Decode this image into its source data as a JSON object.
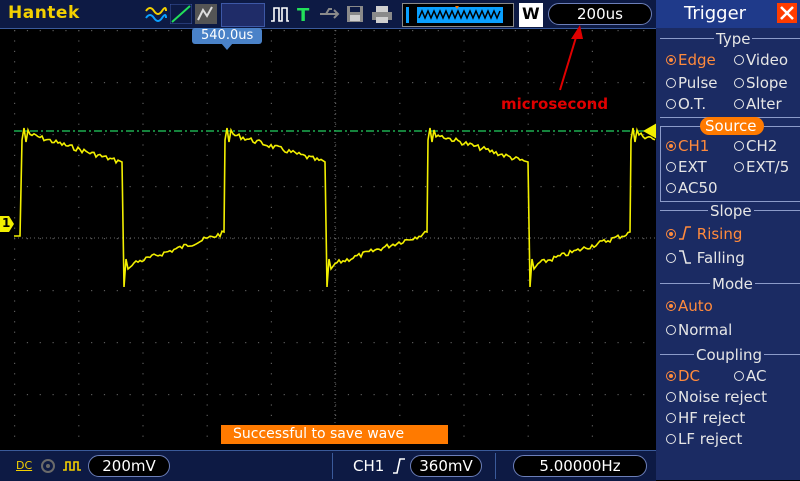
{
  "brand": "Hantek",
  "timebase": "200us",
  "trigger_position": "540.0us",
  "annotation": "microsecond",
  "status_message": "Successful to save wave",
  "acq_mode": "W",
  "channel1": {
    "marker": "1",
    "coupling": "DC",
    "volts_div": "200mV"
  },
  "trigger_readout": {
    "channel": "CH1",
    "level": "360mV",
    "frequency": "5.00000Hz"
  },
  "panel": {
    "title": "Trigger",
    "sections": {
      "type": {
        "title": "Type",
        "options": [
          "Edge",
          "Video",
          "Pulse",
          "Slope",
          "O.T.",
          "Alter"
        ]
      },
      "source": {
        "title": "Source",
        "options": [
          "CH1",
          "CH2",
          "EXT",
          "EXT/5",
          "AC50"
        ]
      },
      "slope": {
        "title": "Slope",
        "options": [
          "Rising",
          "Falling"
        ]
      },
      "mode": {
        "title": "Mode",
        "options": [
          "Auto",
          "Normal"
        ]
      },
      "coupling": {
        "title": "Coupling",
        "options": [
          "DC",
          "AC",
          "Noise reject",
          "HF reject",
          "LF reject"
        ]
      }
    }
  },
  "colors": {
    "trace": "#f2ef00",
    "accent": "#ff7a00",
    "panel_bg": "#1b2b63",
    "annotation": "#e00000"
  }
}
